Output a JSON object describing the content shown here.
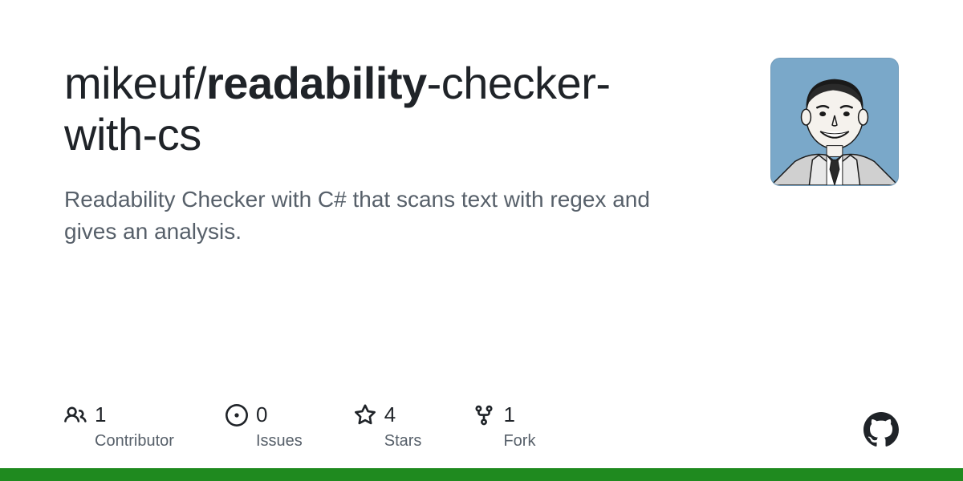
{
  "repo": {
    "owner": "mikeuf",
    "separator": "/",
    "name_part1": "readability",
    "name_part2": "-checker-with-cs",
    "description": "Readability Checker with C# that scans text with regex and gives an analysis."
  },
  "stats": {
    "contributors": {
      "count": "1",
      "label": "Contributor"
    },
    "issues": {
      "count": "0",
      "label": "Issues"
    },
    "stars": {
      "count": "4",
      "label": "Stars"
    },
    "forks": {
      "count": "1",
      "label": "Fork"
    }
  }
}
